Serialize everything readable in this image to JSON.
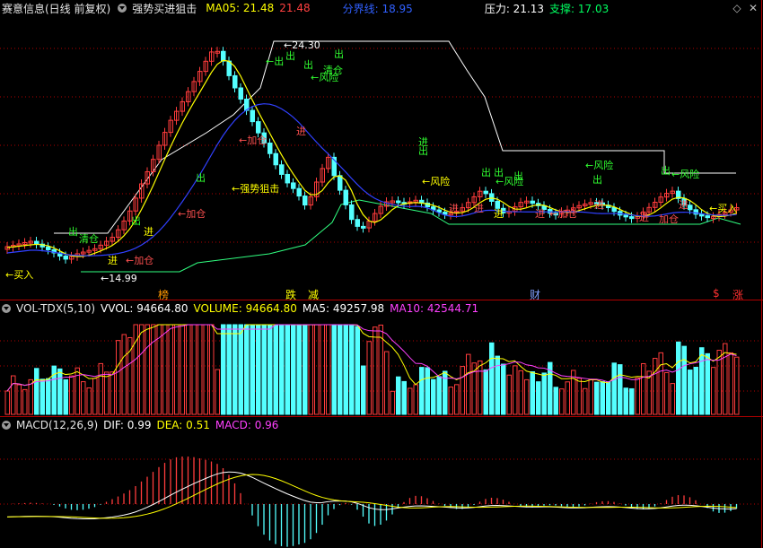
{
  "header": {
    "stock": "赛意信息(日线 前复权)",
    "indicator": "强势买进狙击",
    "ma05": "MA05: 21.48",
    "ma05_val2": "21.48",
    "fenjie": "分界线: 18.95",
    "pressure": "压力: 21.13",
    "support": "支撑: 17.03"
  },
  "events": {
    "bang": "榜",
    "die": "跌",
    "jian": "减",
    "cai": "财",
    "dollar": "$",
    "zhang": "涨"
  },
  "vol_header": {
    "name": "VOL-TDX(5,10)",
    "vvol": "VVOL: 94664.80",
    "volume": "VOLUME: 94664.80",
    "ma5": "MA5: 49257.98",
    "ma10": "MA10: 42544.71"
  },
  "macd_header": {
    "name": "MACD(12,26,9)",
    "dif": "DIF: 0.99",
    "dea": "DEA: 0.51",
    "macd": "MACD: 0.96"
  },
  "price_labels": {
    "high": "24.30",
    "low": "14.99"
  },
  "annotations": [
    {
      "text": "←买入"
    },
    {
      "text": "出"
    },
    {
      "text": "清仓"
    },
    {
      "text": "进"
    },
    {
      "text": "←加仓"
    },
    {
      "text": "出"
    },
    {
      "text": "进"
    },
    {
      "text": "←加仓"
    },
    {
      "text": "出"
    },
    {
      "text": "←强势狙击"
    },
    {
      "text": "←加仓"
    },
    {
      "text": "←出"
    },
    {
      "text": "出"
    },
    {
      "text": "出"
    },
    {
      "text": "清仓"
    },
    {
      "text": "←风险"
    },
    {
      "text": "出"
    },
    {
      "text": "进"
    },
    {
      "text": "进"
    },
    {
      "text": "出"
    },
    {
      "text": "←风险"
    },
    {
      "text": "进"
    },
    {
      "text": "出"
    },
    {
      "text": "出"
    },
    {
      "text": "←风险"
    },
    {
      "text": "出"
    },
    {
      "text": "进"
    },
    {
      "text": "进"
    },
    {
      "text": "进"
    },
    {
      "text": "←加仓"
    },
    {
      "text": "←风险"
    },
    {
      "text": "出"
    },
    {
      "text": "进"
    },
    {
      "text": "出"
    },
    {
      "text": "←风险"
    },
    {
      "text": "进"
    },
    {
      "text": "加仓"
    },
    {
      "text": "进"
    },
    {
      "text": "←买入"
    }
  ],
  "colors": {
    "up": "#ff3c3c",
    "down": "#54ffff",
    "ma5": "#ffff00",
    "ma10": "#ff40ff",
    "grid": "#b00000"
  }
}
